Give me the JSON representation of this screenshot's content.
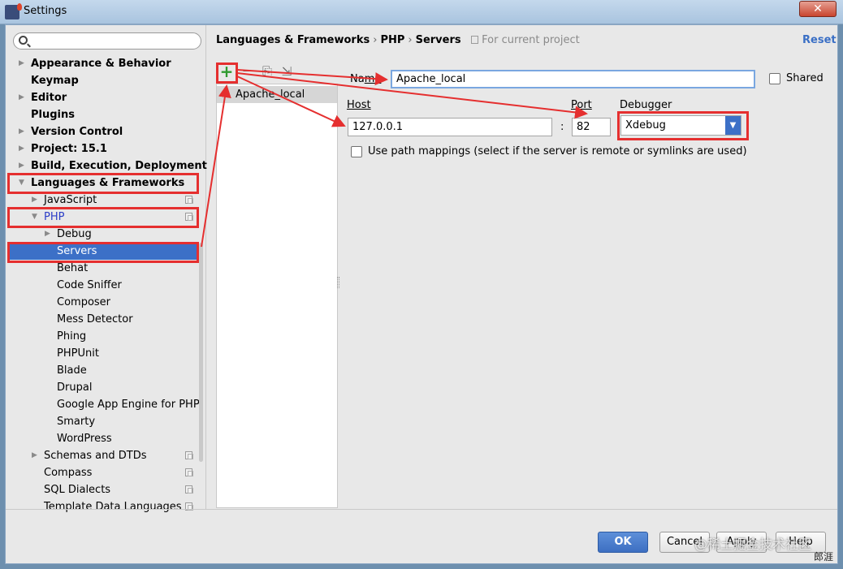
{
  "window": {
    "title": "Settings",
    "close_label": "✕"
  },
  "search": {
    "placeholder": "",
    "value": ""
  },
  "sidebar": {
    "items": [
      {
        "label": "Appearance & Behavior",
        "expanded": false
      },
      {
        "label": "Keymap"
      },
      {
        "label": "Editor",
        "expanded": false
      },
      {
        "label": "Plugins"
      },
      {
        "label": "Version Control",
        "expanded": false
      },
      {
        "label": "Project: 15.1",
        "expanded": false
      },
      {
        "label": "Build, Execution, Deployment",
        "expanded": false
      },
      {
        "label": "Languages & Frameworks",
        "expanded": true,
        "highlighted": true
      },
      {
        "label": "JavaScript",
        "expanded": false
      },
      {
        "label": "PHP",
        "expanded": true,
        "highlighted": true
      },
      {
        "label": "Debug",
        "expanded": false
      },
      {
        "label": "Servers",
        "selected": true,
        "highlighted": true
      },
      {
        "label": "Behat"
      },
      {
        "label": "Code Sniffer"
      },
      {
        "label": "Composer"
      },
      {
        "label": "Mess Detector"
      },
      {
        "label": "Phing"
      },
      {
        "label": "PHPUnit"
      },
      {
        "label": "Blade"
      },
      {
        "label": "Drupal"
      },
      {
        "label": "Google App Engine for PHP"
      },
      {
        "label": "Smarty"
      },
      {
        "label": "WordPress"
      },
      {
        "label": "Schemas and DTDs",
        "expanded": false
      },
      {
        "label": "Compass"
      },
      {
        "label": "SQL Dialects"
      },
      {
        "label": "Template Data Languages"
      }
    ]
  },
  "breadcrumb": {
    "part1": "Languages & Frameworks",
    "part2": "PHP",
    "part3": "Servers",
    "sep": "›",
    "scope": "For current project"
  },
  "reset_label": "Reset",
  "toolbar": {
    "add": "+",
    "remove": "−",
    "copy": "⎘",
    "import": "⇲"
  },
  "servers": [
    "Apache_local"
  ],
  "form": {
    "name_label_1": "Na",
    "name_label_2": "me",
    "name_value": "Apache_local",
    "shared_label": "Shared",
    "host_label": "Host",
    "host_value": "127.0.0.1",
    "colon": ":",
    "port_label": "Port",
    "port_value": "82",
    "debugger_label": "Debugger",
    "debugger_value": "Xdebug",
    "path_mappings_label": "Use path mappings (select if the server is remote or symlinks are used)"
  },
  "buttons": {
    "ok": "OK",
    "cancel": "Cancel",
    "apply": "Apply",
    "help": "Help"
  },
  "watermark": "@稀土掘金技术社区",
  "watermark_2": "郎涯",
  "colors": {
    "selection": "#3c70c7",
    "annotation": "#e52f2f",
    "link": "#3a6fc5"
  }
}
